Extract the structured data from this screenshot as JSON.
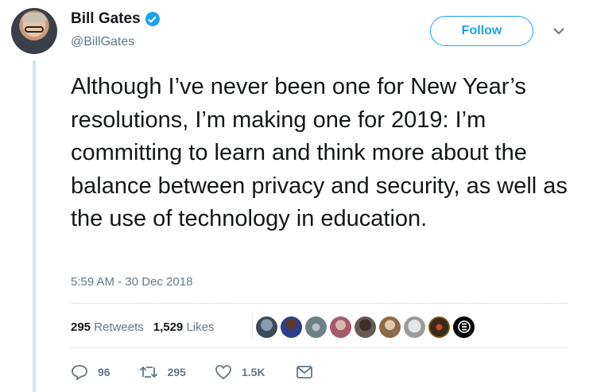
{
  "author": {
    "name": "Bill Gates",
    "handle": "@BillGates",
    "verified_icon": "verified-badge-icon"
  },
  "header": {
    "follow_label": "Follow",
    "menu_icon": "chevron-down-icon"
  },
  "tweet": {
    "text": "Although I’ve never been one for New Year’s resolutions, I’m making one for 2019: I’m committing to learn and think more about the balance between privacy and security, as well as the use of technology in education.",
    "timestamp": "5:59 AM - 30 Dec 2018"
  },
  "stats": {
    "retweets_count": "295",
    "retweets_label": "Retweets",
    "likes_count": "1,529",
    "likes_label": "Likes"
  },
  "actions": {
    "reply_count": "96",
    "retweet_count": "295",
    "like_count": "1.5K"
  },
  "colors": {
    "accent": "#1da1f2",
    "text": "#14171a",
    "muted": "#657786"
  }
}
